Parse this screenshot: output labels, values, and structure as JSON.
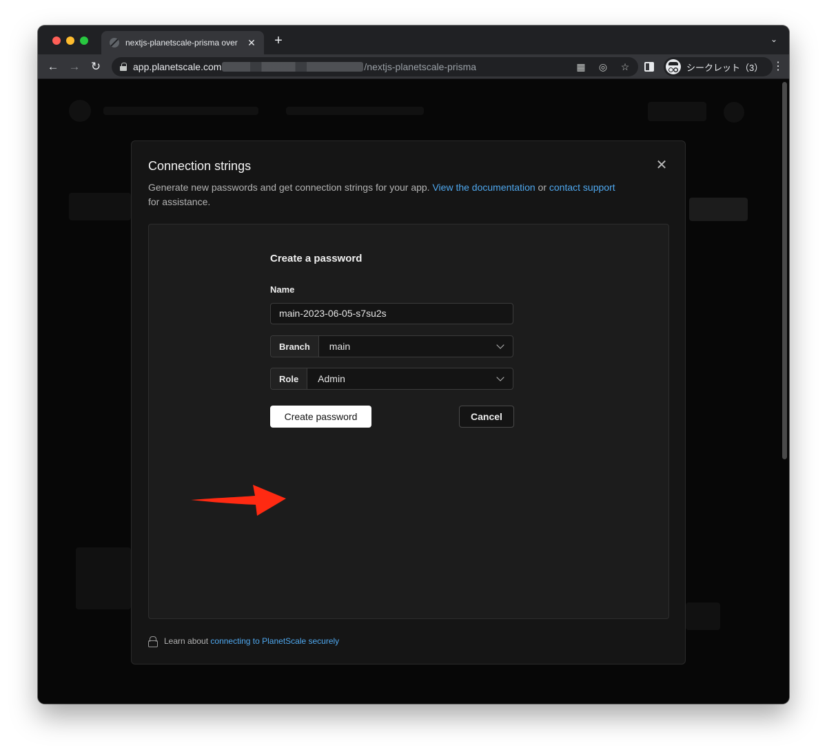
{
  "browser": {
    "tab_title": "nextjs-planetscale-prisma over",
    "url_host": "app.planetscale.com",
    "url_path": "/nextjs-planetscale-prisma",
    "profile_label": "シークレット（3）"
  },
  "modal": {
    "title": "Connection strings",
    "description_prefix": "Generate new passwords and get connection strings for your app. ",
    "doc_link": "View the documentation",
    "or_text": " or ",
    "support_link": "contact support",
    "description_suffix": "for assistance.",
    "form": {
      "title": "Create a password",
      "name_label": "Name",
      "name_value": "main-2023-06-05-s7su2s",
      "branch_label": "Branch",
      "branch_value": "main",
      "role_label": "Role",
      "role_value": "Admin",
      "create_button": "Create password",
      "cancel_button": "Cancel"
    },
    "footer_prefix": "Learn about ",
    "footer_link": "connecting to PlanetScale securely"
  },
  "colors": {
    "accent_link": "#4fa8ef",
    "annotation_arrow": "#ff2a12",
    "modal_bg": "#151515"
  }
}
